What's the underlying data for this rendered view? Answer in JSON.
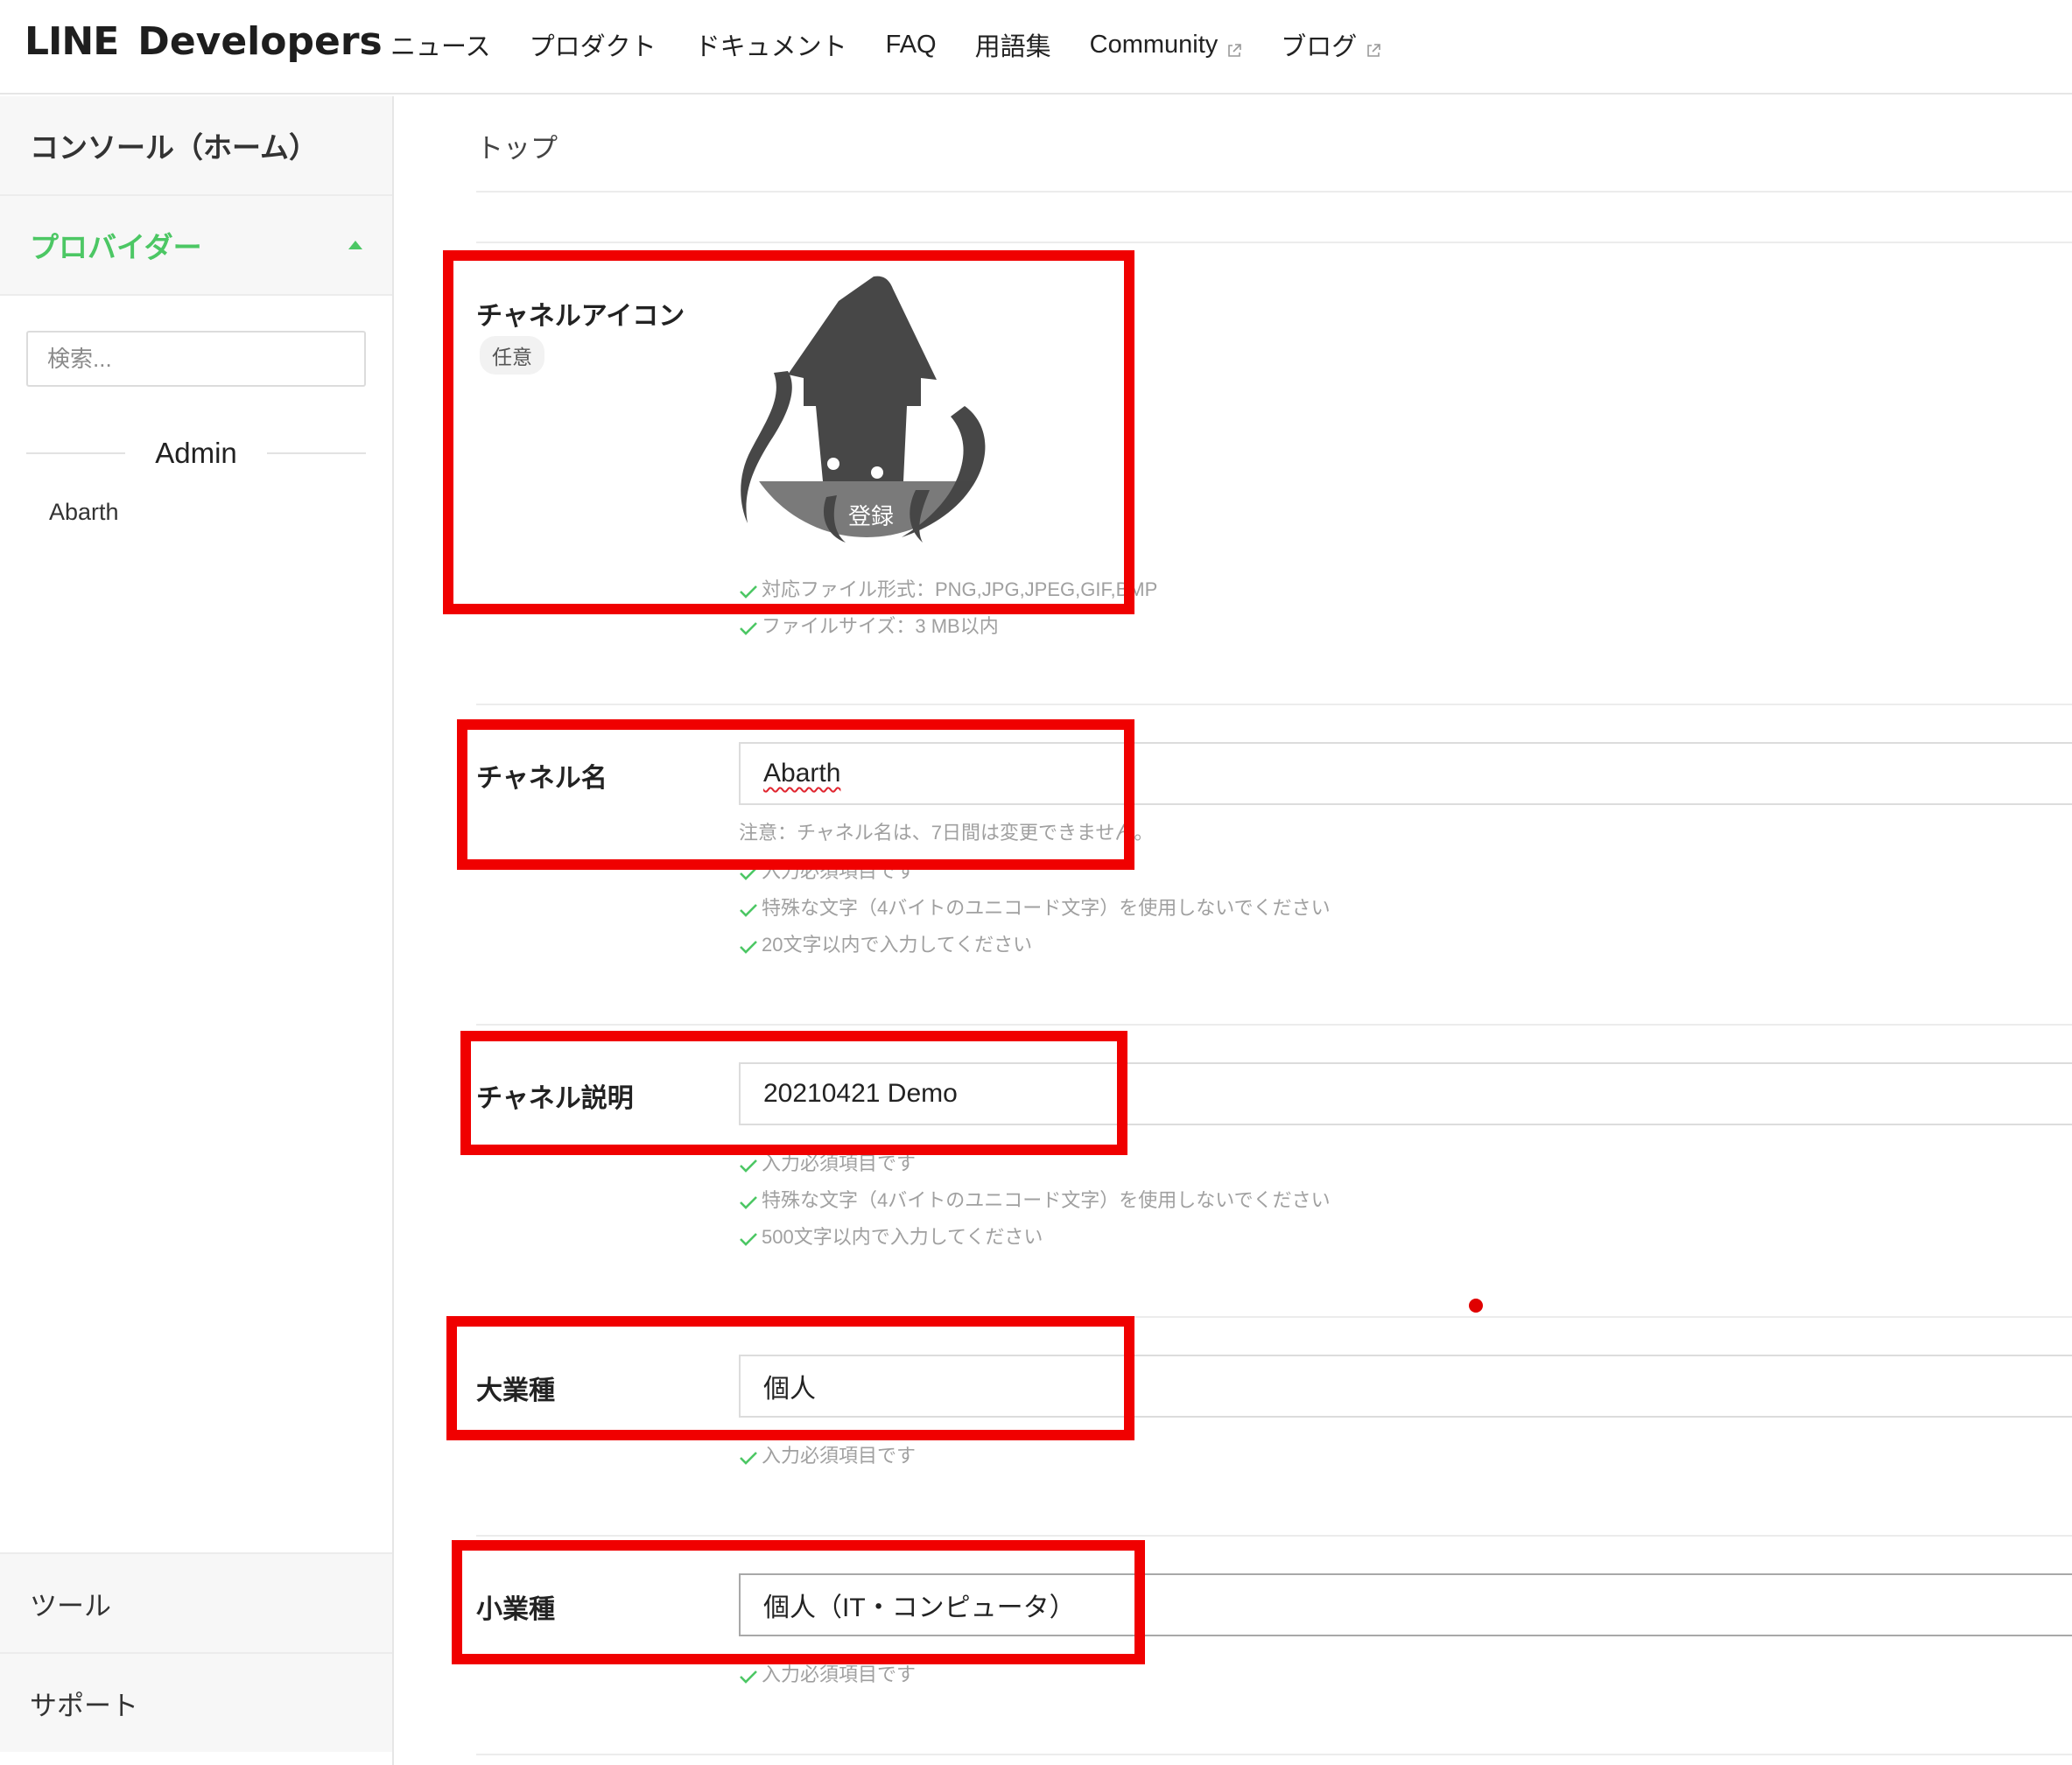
{
  "header": {
    "logo_line": "LINE",
    "logo_dev": "Developers",
    "nav": [
      {
        "label": "ニュース",
        "external": false
      },
      {
        "label": "プロダクト",
        "external": false
      },
      {
        "label": "ドキュメント",
        "external": false
      },
      {
        "label": "FAQ",
        "external": false
      },
      {
        "label": "用語集",
        "external": false
      },
      {
        "label": "Community",
        "external": true
      },
      {
        "label": "ブログ",
        "external": true
      }
    ]
  },
  "sidebar": {
    "console_home": "コンソール（ホーム）",
    "provider": "プロバイダー",
    "search_placeholder": "検索...",
    "group_label": "Admin",
    "provider_item": "Abarth",
    "tools": "ツール",
    "support": "サポート",
    "accent_color": "#4cc764"
  },
  "main": {
    "breadcrumb": "トップ",
    "icon_field": {
      "label": "チャネルアイコン",
      "badge": "任意",
      "register": "登録",
      "hints": [
        "対応ファイル形式：PNG,JPG,JPEG,GIF,BMP",
        "ファイルサイズ：3 MB以内"
      ]
    },
    "name_field": {
      "label": "チャネル名",
      "value": "Abarth",
      "note": "注意：チャネル名は、7日間は変更できません。",
      "hints": [
        "入力必須項目です",
        "特殊な文字（4バイトのユニコード文字）を使用しないでください",
        "20文字以内で入力してください"
      ]
    },
    "desc_field": {
      "label": "チャネル説明",
      "value": "20210421 Demo",
      "hints": [
        "入力必須項目です",
        "特殊な文字（4バイトのユニコード文字）を使用しないでください",
        "500文字以内で入力してください"
      ]
    },
    "industry_field": {
      "label": "大業種",
      "value": "個人",
      "hints": [
        "入力必須項目です"
      ]
    },
    "subindustry_field": {
      "label": "小業種",
      "value": "個人（IT・コンピュータ）",
      "hints": [
        "入力必須項目です"
      ]
    }
  },
  "colors": {
    "highlight": "#f00000",
    "check": "#4cc764"
  }
}
